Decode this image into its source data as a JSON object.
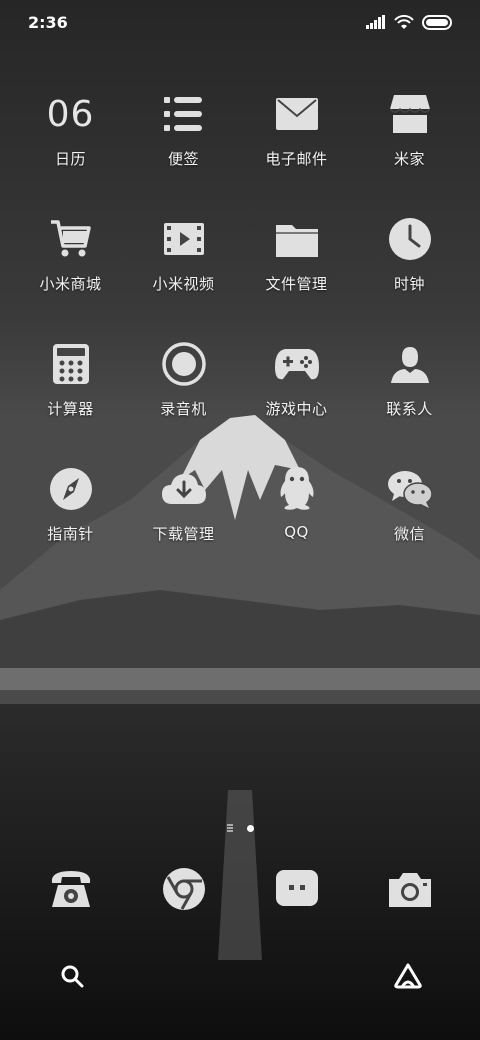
{
  "status_bar": {
    "time": "2:36"
  },
  "apps": [
    {
      "label": "日历",
      "icon": "calendar-icon",
      "date": "06"
    },
    {
      "label": "便签",
      "icon": "notes-list-icon"
    },
    {
      "label": "电子邮件",
      "icon": "mail-icon"
    },
    {
      "label": "米家",
      "icon": "store-icon"
    },
    {
      "label": "小米商城",
      "icon": "shopping-cart-icon"
    },
    {
      "label": "小米视频",
      "icon": "video-icon"
    },
    {
      "label": "文件管理",
      "icon": "folder-icon"
    },
    {
      "label": "时钟",
      "icon": "clock-icon"
    },
    {
      "label": "计算器",
      "icon": "calculator-icon"
    },
    {
      "label": "录音机",
      "icon": "recorder-icon"
    },
    {
      "label": "游戏中心",
      "icon": "gamepad-icon"
    },
    {
      "label": "联系人",
      "icon": "contact-icon"
    },
    {
      "label": "指南针",
      "icon": "compass-icon"
    },
    {
      "label": "下载管理",
      "icon": "cloud-download-icon"
    },
    {
      "label": "QQ",
      "icon": "qq-penguin-icon"
    },
    {
      "label": "微信",
      "icon": "wechat-icon"
    }
  ],
  "dock": [
    {
      "icon": "phone-icon"
    },
    {
      "icon": "browser-icon"
    },
    {
      "icon": "messages-icon"
    },
    {
      "icon": "camera-icon"
    }
  ],
  "bottom_bar": [
    {
      "icon": "search-icon"
    },
    {
      "icon": "assistant-icon"
    }
  ]
}
